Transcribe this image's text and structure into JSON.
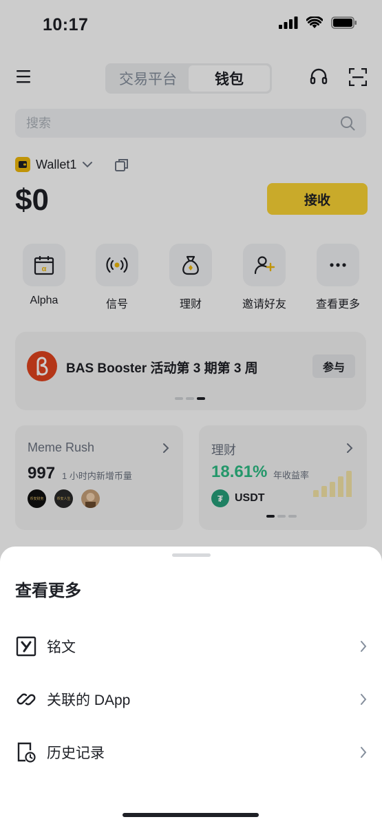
{
  "status_bar": {
    "time": "10:17"
  },
  "header": {
    "tabs": [
      {
        "label": "交易平台",
        "active": false
      },
      {
        "label": "钱包",
        "active": true
      }
    ],
    "icons": [
      "menu-icon",
      "headset-icon",
      "scan-icon"
    ]
  },
  "search": {
    "placeholder": "搜索"
  },
  "wallet": {
    "name": "Wallet1",
    "balance": "$0",
    "receive_label": "接收"
  },
  "quick_actions": [
    {
      "label": "Alpha",
      "icon": "alpha-calendar-icon"
    },
    {
      "label": "信号",
      "icon": "signal-icon"
    },
    {
      "label": "理财",
      "icon": "money-bag-icon"
    },
    {
      "label": "邀请好友",
      "icon": "invite-friend-icon"
    },
    {
      "label": "查看更多",
      "icon": "more-icon"
    }
  ],
  "banner": {
    "title": "BAS Booster 活动第 3 期第 3 周",
    "join_label": "参与"
  },
  "cards": {
    "meme": {
      "title": "Meme Rush",
      "count": "997",
      "subtitle": "1 小时内新增币量",
      "avatars": [
        "币安财务",
        "币安人生",
        ""
      ]
    },
    "earn": {
      "title": "理财",
      "apy": "18.61%",
      "apy_label": "年收益率",
      "asset": "USDT"
    }
  },
  "sheet": {
    "title": "查看更多",
    "items": [
      {
        "label": "铭文",
        "icon": "inscription-icon"
      },
      {
        "label": "关联的 DApp",
        "icon": "link-icon"
      },
      {
        "label": "历史记录",
        "icon": "history-icon"
      }
    ]
  },
  "colors": {
    "accent": "#fcd535",
    "positive": "#2ebd85",
    "text": "#1e2026",
    "muted": "#848e9c"
  }
}
